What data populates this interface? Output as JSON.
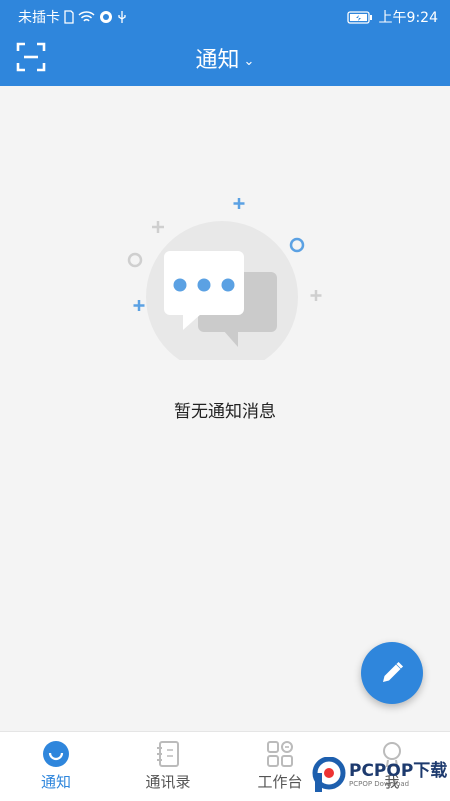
{
  "status": {
    "carrier": "未插卡",
    "time": "上午9:24"
  },
  "header": {
    "title": "通知",
    "scan_icon": "scan-icon",
    "dropdown_icon": "chevron-down-icon"
  },
  "empty": {
    "message": "暂无通知消息",
    "icon": "chat-bubbles-icon"
  },
  "fab": {
    "icon": "pencil-icon"
  },
  "tabs": [
    {
      "label": "通知",
      "icon": "notify-icon",
      "active": true
    },
    {
      "label": "通讯录",
      "icon": "contacts-icon",
      "active": false
    },
    {
      "label": "工作台",
      "icon": "workbench-icon",
      "active": false
    },
    {
      "label": "我",
      "icon": "me-icon",
      "active": false
    }
  ],
  "watermark": {
    "text": "PCPOP下载",
    "sub": "PCPOP Download"
  },
  "colors": {
    "primary": "#2f86dc",
    "background": "#f4f4f4"
  }
}
